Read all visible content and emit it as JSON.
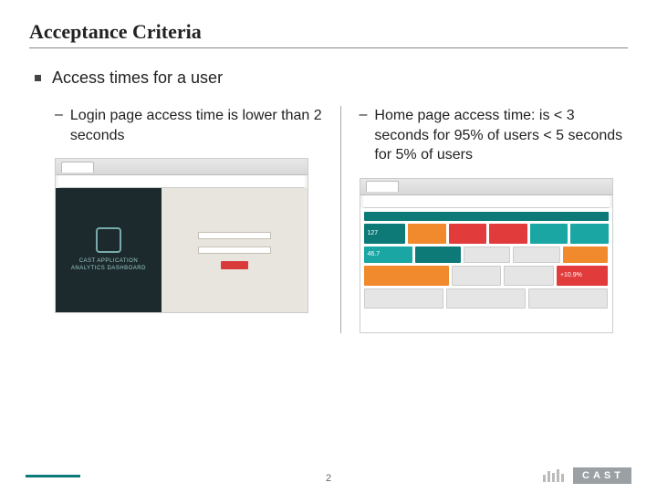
{
  "title": "Acceptance Criteria",
  "main_bullet": "Access times for a user",
  "left": {
    "text": "Login page access time is lower than  2 seconds",
    "brand_line1": "CAST APPLICATION",
    "brand_line2": "ANALYTICS DASHBOARD"
  },
  "right": {
    "text": "Home page access time: is < 3 seconds for 95% of users < 5 seconds for 5% of users",
    "tile_num1": "127",
    "tile_num2": "46.7",
    "tile_num3": "+10.9%"
  },
  "page_number": "2",
  "logo_text": "CAST"
}
